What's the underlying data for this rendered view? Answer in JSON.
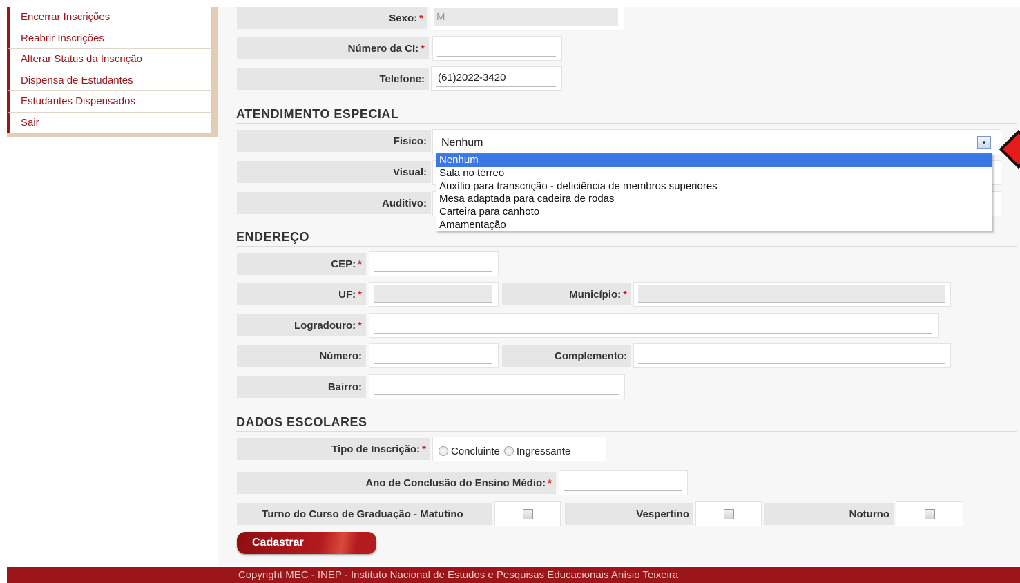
{
  "sidebar": {
    "items": [
      {
        "label": "Encerrar Inscrições"
      },
      {
        "label": "Reabrir Inscrições"
      },
      {
        "label": "Alterar Status da Inscrição"
      },
      {
        "label": "Dispensa de Estudantes"
      },
      {
        "label": "Estudantes Dispensados"
      },
      {
        "label": "Sair"
      }
    ]
  },
  "personal": {
    "sexo_label": "Sexo:",
    "sexo_value": "M",
    "ci_label": "Número da CI:",
    "ci_value": "",
    "telefone_label": "Telefone:",
    "telefone_value": "(61)2022-3420"
  },
  "required_mark": "*",
  "atendimento": {
    "section_title": "ATENDIMENTO ESPECIAL",
    "fisico_label": "Físico:",
    "fisico_value": "Nenhum",
    "visual_label": "Visual:",
    "auditivo_label": "Auditivo:",
    "dropdown_options": [
      "Nenhum",
      "Sala no térreo",
      "Auxílio para transcrição - deficiência de membros superiores",
      "Mesa adaptada para cadeira de rodas",
      "Carteira para canhoto",
      "Amamentação"
    ],
    "dropdown_selected_index": 0
  },
  "endereco": {
    "section_title": "ENDEREÇO",
    "cep_label": "CEP:",
    "uf_label": "UF:",
    "municipio_label": "Município:",
    "logradouro_label": "Logradouro:",
    "numero_label": "Número:",
    "complemento_label": "Complemento:",
    "bairro_label": "Bairro:"
  },
  "escolares": {
    "section_title": "DADOS ESCOLARES",
    "tipo_label": "Tipo de Inscrição:",
    "tipo_options": [
      "Concluinte",
      "Ingressante"
    ],
    "ano_label": "Ano de Conclusão do Ensino Médio:",
    "turno_label": "Turno do Curso de Graduação - Matutino",
    "vespertino_label": "Vespertino",
    "noturno_label": "Noturno"
  },
  "submit_label": "Cadastrar",
  "footer_text": "Copyright MEC - INEP - Instituto Nacional de Estudos e Pesquisas Educacionais Anísio Teixeira",
  "colors": {
    "brand_red": "#9c1519",
    "sidebar_bg": "#e3cdb6",
    "selection_blue": "#3b78e7"
  }
}
